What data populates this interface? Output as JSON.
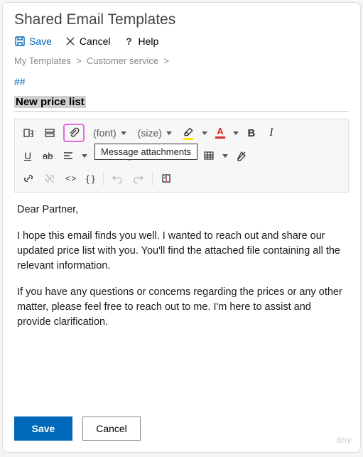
{
  "title": "Shared Email Templates",
  "actions": {
    "save": "Save",
    "cancel": "Cancel",
    "help": "Help"
  },
  "breadcrumb": {
    "root": "My Templates",
    "folder": "Customer service"
  },
  "hash_marker": "##",
  "template_name": "New price list",
  "toolbar": {
    "font_placeholder": "(font)",
    "size_placeholder": "(size)",
    "bold_symbol": "B",
    "italic_symbol": "I",
    "underline_symbol": "U",
    "strike_symbol": "ab",
    "color_glyph": "A",
    "code_glyph": "< >",
    "braces_glyph": "{ }",
    "tooltip": "Message attachments"
  },
  "body": {
    "greeting": "Dear Partner,",
    "para1": "I hope this email finds you well. I wanted to reach out and share our updated price list with you. You'll find the attached file containing all the relevant information.",
    "para2": "If you have any questions or concerns regarding the prices or any other matter, please feel free to reach out to me. I'm here to assist and provide clarification."
  },
  "footer": {
    "save": "Save",
    "cancel": "Cancel"
  },
  "branding": "tiny"
}
